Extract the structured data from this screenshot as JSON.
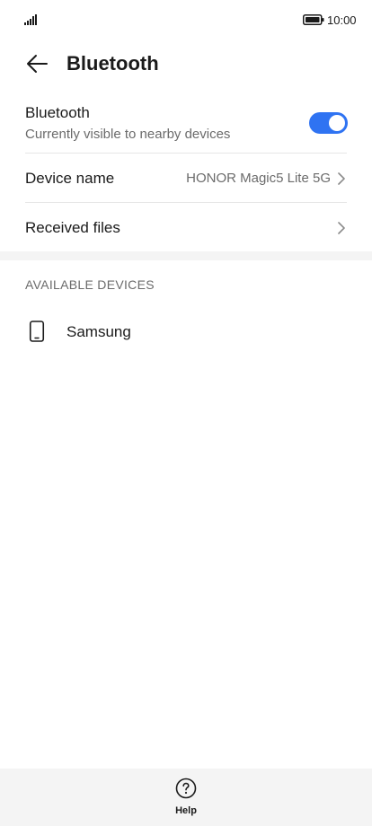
{
  "status_bar": {
    "time": "10:00",
    "signal_icon": "signal-icon",
    "battery_icon": "battery-icon"
  },
  "header": {
    "back_icon": "arrow-left-icon",
    "title": "Bluetooth"
  },
  "settings": {
    "bluetooth": {
      "label": "Bluetooth",
      "subtitle": "Currently visible to nearby devices",
      "enabled": true
    },
    "device_name": {
      "label": "Device name",
      "value": "HONOR Magic5 Lite 5G"
    },
    "received_files": {
      "label": "Received files"
    }
  },
  "available_devices": {
    "header": "AVAILABLE DEVICES",
    "items": [
      {
        "name": "Samsung",
        "icon": "smartphone-icon"
      }
    ]
  },
  "bottom_bar": {
    "help_label": "Help",
    "help_icon": "question-circle-icon"
  },
  "colors": {
    "accent": "#2f73f2",
    "secondary_text": "#6b6b6b",
    "section_bg": "#f4f4f4"
  }
}
